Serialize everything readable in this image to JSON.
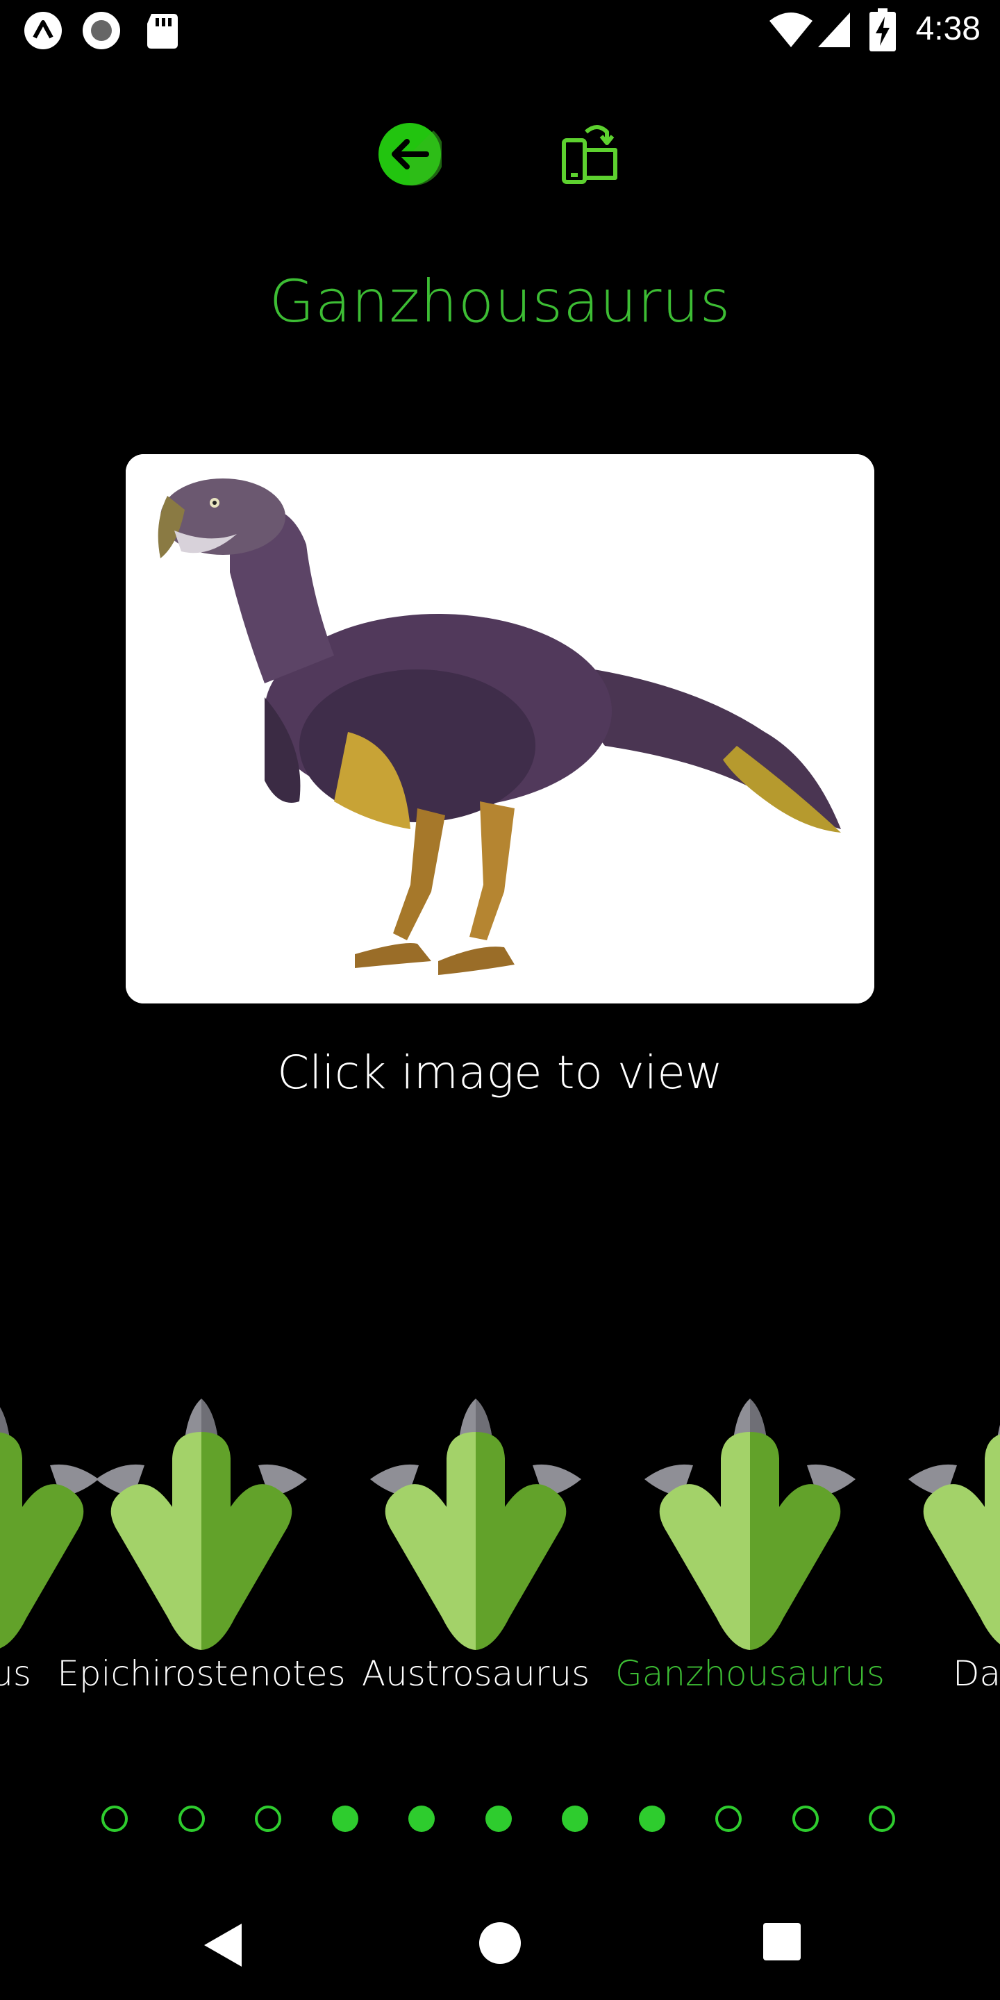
{
  "status_bar": {
    "time": "4:38",
    "left_icons": [
      "app-logo-icon",
      "record-icon",
      "sd-card-icon"
    ],
    "right_icons": [
      "wifi-icon",
      "signal-icon",
      "battery-charging-icon"
    ]
  },
  "header": {
    "back_icon": "arrow-left-icon",
    "rotate_icon": "screen-rotation-icon"
  },
  "dino": {
    "name": "Ganzhousaurus",
    "hint": "Click image to view"
  },
  "carousel": {
    "items": [
      {
        "label": "urus",
        "selected": false
      },
      {
        "label": "Epichirostenotes",
        "selected": false
      },
      {
        "label": "Austrosaurus",
        "selected": false
      },
      {
        "label": "Ganzhousaurus",
        "selected": true
      },
      {
        "label": "Dahalo",
        "selected": false
      }
    ]
  },
  "pagination": {
    "total": 11,
    "filled": [
      false,
      false,
      false,
      true,
      true,
      true,
      true,
      true,
      false,
      false,
      false
    ]
  },
  "colors": {
    "accent": "#2ecc2e",
    "title": "#3dbd34",
    "rotate_icon": "#5dd12f",
    "footprint_light": "#a3d269",
    "footprint_dark": "#62a22a",
    "claw_grey": "#8f8f96",
    "claw_grey_dark": "#6f6f76",
    "background": "#000000"
  },
  "nav_bar": {
    "icons": [
      "nav-back-icon",
      "nav-home-icon",
      "nav-recents-icon"
    ]
  }
}
